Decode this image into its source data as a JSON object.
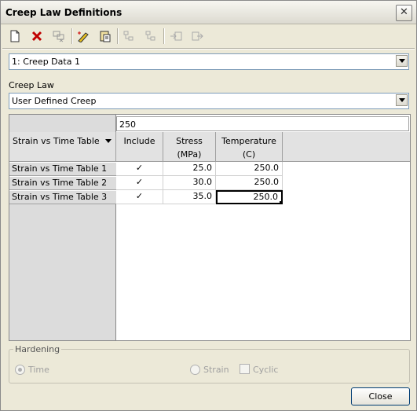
{
  "window": {
    "title": "Creep Law Definitions",
    "close_glyph": "✕"
  },
  "toolbar": {
    "icons": [
      "new-icon",
      "delete-icon",
      "copy-disabled-icon",
      "edit-icon",
      "paste-icon",
      "tree-copy-disabled-icon",
      "tree-paste-disabled-icon",
      "import-disabled-icon",
      "export-disabled-icon"
    ]
  },
  "creep_data_select": {
    "value": "1: Creep Data 1"
  },
  "creep_law": {
    "label": "Creep Law",
    "value": "User Defined Creep"
  },
  "table": {
    "edit_value": "250",
    "table_selector": "Strain vs Time Table",
    "columns": [
      {
        "line1": "Include",
        "line2": ""
      },
      {
        "line1": "Stress",
        "line2": "(MPa)"
      },
      {
        "line1": "Temperature",
        "line2": "(C)"
      }
    ],
    "rows": [
      {
        "name": "Strain vs Time Table 1",
        "include": "✓",
        "stress": "25.0",
        "temperature": "250.0"
      },
      {
        "name": "Strain vs Time Table 2",
        "include": "✓",
        "stress": "30.0",
        "temperature": "250.0"
      },
      {
        "name": "Strain vs Time Table 3",
        "include": "✓",
        "stress": "35.0",
        "temperature": "250.0"
      }
    ]
  },
  "hardening": {
    "label": "Hardening",
    "time": "Time",
    "strain": "Strain",
    "cyclic": "Cyclic"
  },
  "close_button": "Close"
}
